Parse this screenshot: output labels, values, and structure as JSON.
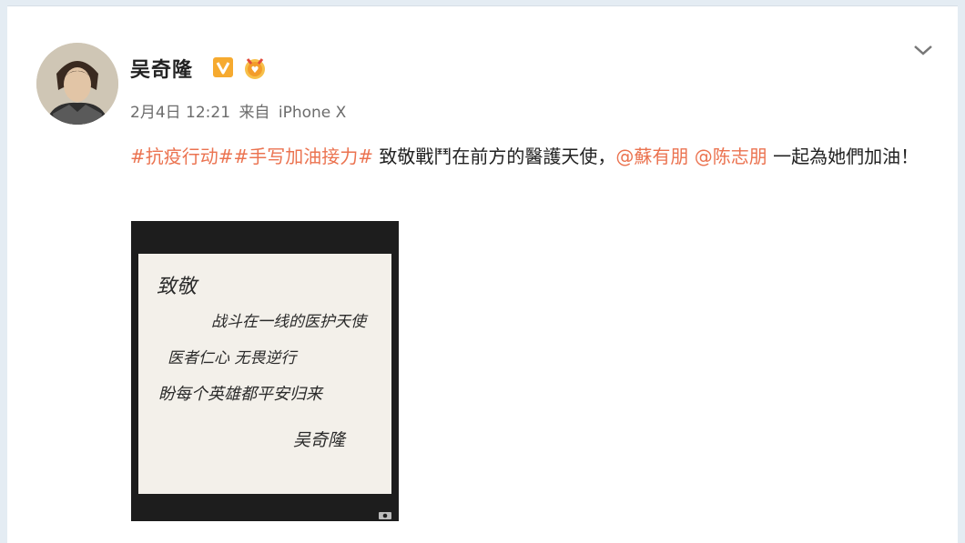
{
  "post": {
    "author": "吴奇隆",
    "meta": {
      "date": "2月4日 12:21",
      "from": "来自",
      "device": "iPhone X"
    },
    "text": {
      "hashtag1": "#抗疫行动#",
      "hashtag2": "#手写加油接力#",
      "segment1": " 致敬戰鬥在前方的醫護天使，",
      "mention1": "@蘇有朋",
      "mention2": "@陈志朋",
      "segment2": " 一起為她們加油！"
    },
    "image": {
      "note_lines": [
        "致敬",
        "战斗在一线的医护天使",
        "医者仁心  无畏逆行",
        "盼每个英雄都平安归来",
        "吴奇隆"
      ]
    }
  },
  "colors": {
    "link": "#eb7350",
    "verified_badge": "#f6aa2f",
    "background": "#e4ecf3"
  },
  "icons": [
    "verified-v-icon",
    "medal-icon",
    "chevron-down-icon",
    "camera-icon"
  ]
}
